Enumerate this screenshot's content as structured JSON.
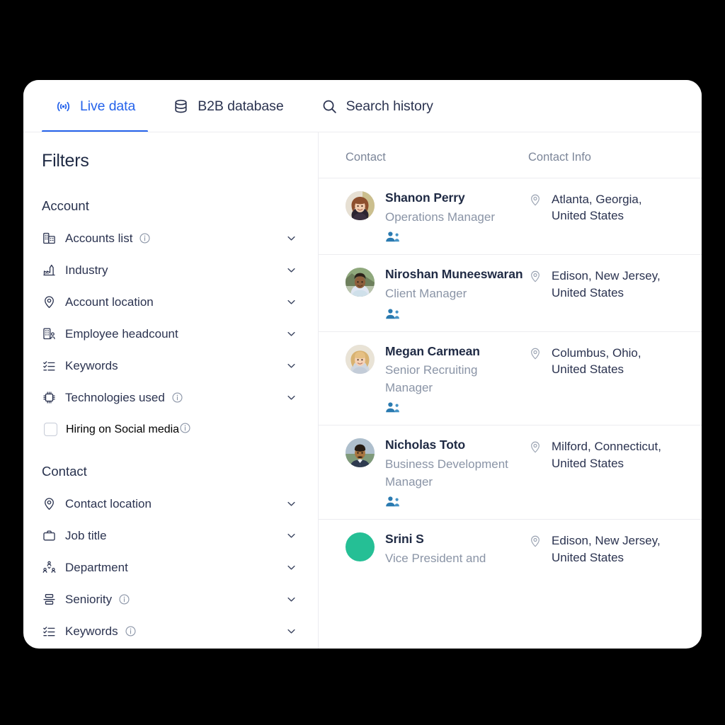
{
  "theme": {
    "background": "#000000",
    "card_background": "#ffffff",
    "accent_blue": "#2563eb",
    "text_dark": "#1f2a44",
    "text_muted": "#8a94a6",
    "header_muted": "#7c8699",
    "divider": "#ececf0",
    "people_icon_blue": "#2a7ab0",
    "avatar_green": "#25bf95"
  },
  "tabs": [
    {
      "label": "Live data",
      "icon": "broadcast-icon",
      "active": true
    },
    {
      "label": "B2B database",
      "icon": "database-icon",
      "active": false
    },
    {
      "label": "Search history",
      "icon": "search-icon",
      "active": false
    }
  ],
  "sidebar": {
    "title": "Filters",
    "groups": [
      {
        "name": "Account",
        "items": [
          {
            "label": "Accounts list",
            "icon": "buildings-icon",
            "info": true,
            "chevron": true,
            "type": "expander"
          },
          {
            "label": "Industry",
            "icon": "factory-icon",
            "info": false,
            "chevron": true,
            "type": "expander"
          },
          {
            "label": "Account location",
            "icon": "map-pin-icon",
            "info": false,
            "chevron": true,
            "type": "expander"
          },
          {
            "label": "Employee headcount",
            "icon": "building-person-icon",
            "info": false,
            "chevron": true,
            "type": "expander"
          },
          {
            "label": "Keywords",
            "icon": "checklist-icon",
            "info": false,
            "chevron": true,
            "type": "expander"
          },
          {
            "label": "Technologies used",
            "icon": "chip-icon",
            "info": true,
            "chevron": true,
            "type": "expander"
          },
          {
            "label": "Hiring on Social media",
            "icon": "checkbox-icon",
            "info": true,
            "chevron": false,
            "type": "checkbox",
            "checked": false
          }
        ]
      },
      {
        "name": "Contact",
        "items": [
          {
            "label": "Contact location",
            "icon": "map-pin-icon",
            "info": false,
            "chevron": true,
            "type": "expander"
          },
          {
            "label": "Job title",
            "icon": "briefcase-icon",
            "info": false,
            "chevron": true,
            "type": "expander"
          },
          {
            "label": "Department",
            "icon": "org-chart-icon",
            "info": false,
            "chevron": true,
            "type": "expander"
          },
          {
            "label": "Seniority",
            "icon": "hierarchy-icon",
            "info": true,
            "chevron": true,
            "type": "expander"
          },
          {
            "label": "Keywords",
            "icon": "checklist-icon",
            "info": true,
            "chevron": true,
            "type": "expander"
          }
        ]
      }
    ]
  },
  "results": {
    "columns": {
      "contact": "Contact",
      "contact_info": "Contact Info"
    },
    "rows": [
      {
        "name": "Shanon Perry",
        "title": "Operations Manager",
        "location": "Atlanta, Georgia, United States",
        "avatar_type": "photo",
        "avatar_tone": "#c8a982",
        "people_icon": "people-icon"
      },
      {
        "name": "Niroshan Muneeswaran",
        "title": "Client Manager",
        "location": "Edison, New Jersey, United States",
        "avatar_type": "photo",
        "avatar_tone": "#6f8f62",
        "people_icon": "people-icon"
      },
      {
        "name": "Megan Carmean",
        "title": "Senior Recruiting Manager",
        "location": "Columbus, Ohio, United States",
        "avatar_type": "photo",
        "avatar_tone": "#cfae86",
        "people_icon": "people-icon"
      },
      {
        "name": "Nicholas Toto",
        "title": "Business Development Manager",
        "location": "Milford, Connecticut, United States",
        "avatar_type": "photo",
        "avatar_tone": "#7e8fa3",
        "people_icon": "people-icon"
      },
      {
        "name": "Srini S",
        "title": "Vice President and",
        "location": "Edison, New Jersey, United States",
        "avatar_type": "solid",
        "avatar_tone": "#25bf95",
        "people_icon": null
      }
    ]
  }
}
